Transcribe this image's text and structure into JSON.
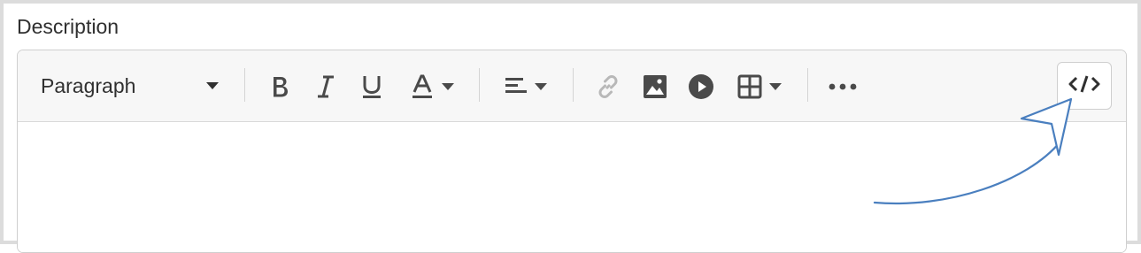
{
  "field": {
    "label": "Description"
  },
  "toolbar": {
    "format_select": {
      "value": "Paragraph"
    },
    "buttons": [
      {
        "name": "bold",
        "icon": "bold-icon"
      },
      {
        "name": "italic",
        "icon": "italic-icon"
      },
      {
        "name": "underline",
        "icon": "underline-icon"
      },
      {
        "name": "text-color",
        "icon": "text-color-icon"
      },
      {
        "name": "align",
        "icon": "align-left-icon"
      },
      {
        "name": "link",
        "icon": "link-icon"
      },
      {
        "name": "image",
        "icon": "image-icon"
      },
      {
        "name": "video",
        "icon": "play-icon"
      },
      {
        "name": "table",
        "icon": "table-icon"
      },
      {
        "name": "more",
        "icon": "more-icon"
      },
      {
        "name": "html-source",
        "icon": "code-icon"
      }
    ]
  },
  "editor": {
    "content": ""
  },
  "colors": {
    "annotation_arrow": "#4a7fbf",
    "icon": "#4a4a4a",
    "disabled_icon": "#b8b8b8"
  }
}
